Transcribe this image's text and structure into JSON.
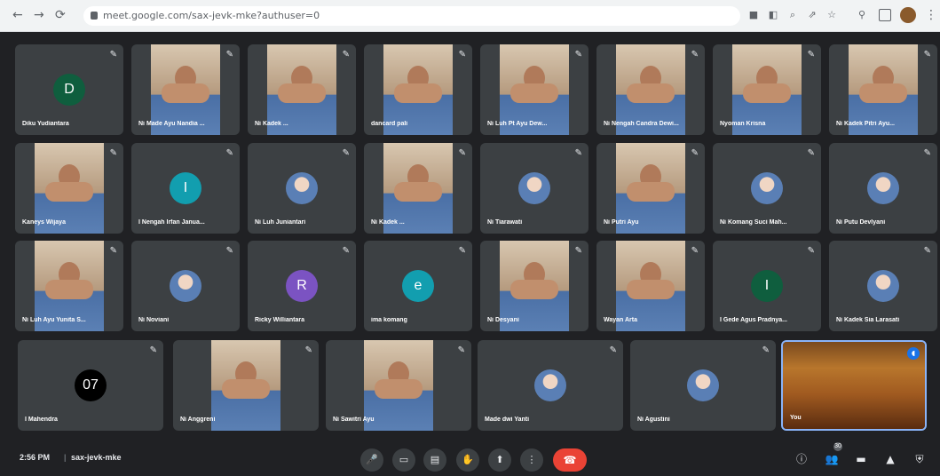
{
  "browser": {
    "back": "←",
    "forward": "→",
    "reload": "⟳",
    "url": "meet.google.com/sax-jevk-mke?authuser=0",
    "icons": [
      "video-camera-icon",
      "extension-icon",
      "search-icon",
      "share-icon",
      "star-icon",
      "extensions-icon",
      "window-icon"
    ],
    "menu": "⋮"
  },
  "tiles": [
    {
      "name": "Diku Yudiantara",
      "type": "avatar",
      "initial": "D",
      "color": "#0f5e3e"
    },
    {
      "name": "Ni Made Ayu Nandia ...",
      "type": "video"
    },
    {
      "name": "Ni Kadek ...",
      "type": "video"
    },
    {
      "name": "dancard pali",
      "type": "video"
    },
    {
      "name": "Ni Luh Pt Ayu Dew...",
      "type": "video"
    },
    {
      "name": "Ni Nengah Candra Dewi...",
      "type": "video"
    },
    {
      "name": "Nyoman Krisna",
      "type": "video"
    },
    {
      "name": "Ni Kadek Pitri Ayu...",
      "type": "video"
    },
    {
      "name": "Kaneys Wijaya",
      "type": "video"
    },
    {
      "name": "I Nengah Irfan Janua...",
      "type": "avatar",
      "initial": "I",
      "color": "#129eaf"
    },
    {
      "name": "Ni Luh Juniantari",
      "type": "photo"
    },
    {
      "name": "Ni Kadek ...",
      "type": "video"
    },
    {
      "name": "Ni Tiarawati",
      "type": "photo"
    },
    {
      "name": "Ni Putri Ayu",
      "type": "video"
    },
    {
      "name": "Ni Komang Suci Mah...",
      "type": "photo"
    },
    {
      "name": "Ni Putu Devlyani",
      "type": "photo"
    },
    {
      "name": "Ni Luh Ayu Yunita S...",
      "type": "video"
    },
    {
      "name": "Ni Noviani",
      "type": "photo"
    },
    {
      "name": "Ricky Williantara",
      "type": "avatar",
      "initial": "R",
      "color": "#7b53c2"
    },
    {
      "name": "ima komang",
      "type": "avatar",
      "initial": "e",
      "color": "#129eaf"
    },
    {
      "name": "Ni Desyani",
      "type": "video"
    },
    {
      "name": "Wayan Arta",
      "type": "video"
    },
    {
      "name": "I Gede Agus Pradnya...",
      "type": "avatar",
      "initial": "I",
      "color": "#0f5e3e"
    },
    {
      "name": "Ni Kadek Sia Larasati",
      "type": "photo"
    },
    {
      "name": "I Mahendra",
      "type": "avatar",
      "initial": "07",
      "color": "#000000"
    },
    {
      "name": "Ni Anggreni",
      "type": "video"
    },
    {
      "name": "Ni Sawitri Ayu",
      "type": "video"
    },
    {
      "name": "Made dwi Yanti",
      "type": "photo"
    },
    {
      "name": "Ni Agustini",
      "type": "photo"
    },
    {
      "name": "You",
      "type": "you"
    }
  ],
  "bottom": {
    "time": "2:56 PM",
    "separator": "|",
    "code": "sax-jevk-mke",
    "controls": [
      {
        "name": "mic-button",
        "glyph": "🎤"
      },
      {
        "name": "camera-button",
        "glyph": "▭"
      },
      {
        "name": "captions-button",
        "glyph": "▤"
      },
      {
        "name": "raise-hand-button",
        "glyph": "✋"
      },
      {
        "name": "present-button",
        "glyph": "⬆"
      },
      {
        "name": "more-options-button",
        "glyph": "⋮"
      }
    ],
    "end_call": "☎",
    "right": [
      {
        "name": "info-icon",
        "glyph": "ⓘ"
      },
      {
        "name": "people-icon",
        "glyph": "👥"
      },
      {
        "name": "chat-icon",
        "glyph": "▬"
      },
      {
        "name": "activities-icon",
        "glyph": "▲"
      },
      {
        "name": "host-controls-icon",
        "glyph": "⛨"
      }
    ],
    "participants_badge": "30"
  }
}
